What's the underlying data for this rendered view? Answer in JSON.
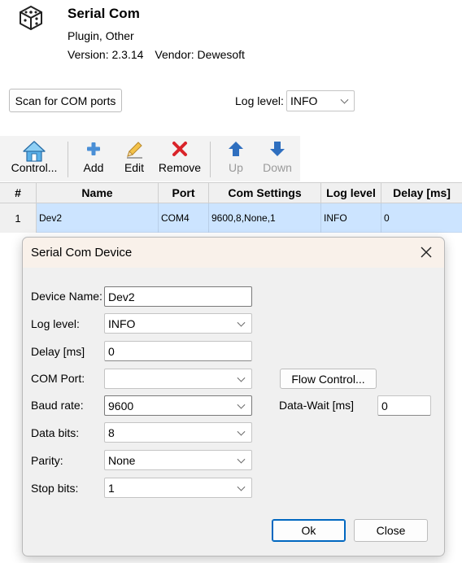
{
  "plugin": {
    "title": "Serial Com",
    "category": "Plugin, Other",
    "version": "Version: 2.3.14",
    "vendor": "Vendor: Dewesoft"
  },
  "top": {
    "scan_button": "Scan for COM ports",
    "log_level_label": "Log level:",
    "log_level_value": "INFO"
  },
  "toolbar": {
    "control": "Control...",
    "add": "Add",
    "edit": "Edit",
    "remove": "Remove",
    "up": "Up",
    "down": "Down"
  },
  "table": {
    "headers": [
      "#",
      "Name",
      "Port",
      "Com Settings",
      "Log level",
      "Delay [ms]"
    ],
    "rows": [
      [
        "1",
        "Dev2",
        "COM4",
        "9600,8,None,1",
        "INFO",
        "0"
      ]
    ]
  },
  "dialog": {
    "title": "Serial Com Device",
    "device_name_label": "Device Name:",
    "device_name_value": "Dev2",
    "log_level_label": "Log level:",
    "log_level_value": "INFO",
    "delay_label": "Delay [ms]",
    "delay_value": "0",
    "com_port_label": "COM Port:",
    "com_port_value": "",
    "baud_rate_label": "Baud rate:",
    "baud_rate_value": "9600",
    "data_bits_label": "Data bits:",
    "data_bits_value": "8",
    "parity_label": "Parity:",
    "parity_value": "None",
    "stop_bits_label": "Stop bits:",
    "stop_bits_value": "1",
    "flow_control_button": "Flow Control...",
    "data_wait_label": "Data-Wait [ms]",
    "data_wait_value": "0",
    "ok_button": "Ok",
    "close_button": "Close"
  },
  "colors": {
    "selection": "#cce4ff",
    "accent": "#0067c0",
    "remove_red": "#d9242a",
    "arrow_blue": "#2f6fbf"
  },
  "icons": {
    "plugin": "cube-icon",
    "control": "home-icon",
    "add": "plus-icon",
    "edit": "pencil-icon",
    "remove": "x-icon",
    "up": "arrow-up-icon",
    "down": "arrow-down-icon",
    "close": "close-icon"
  }
}
